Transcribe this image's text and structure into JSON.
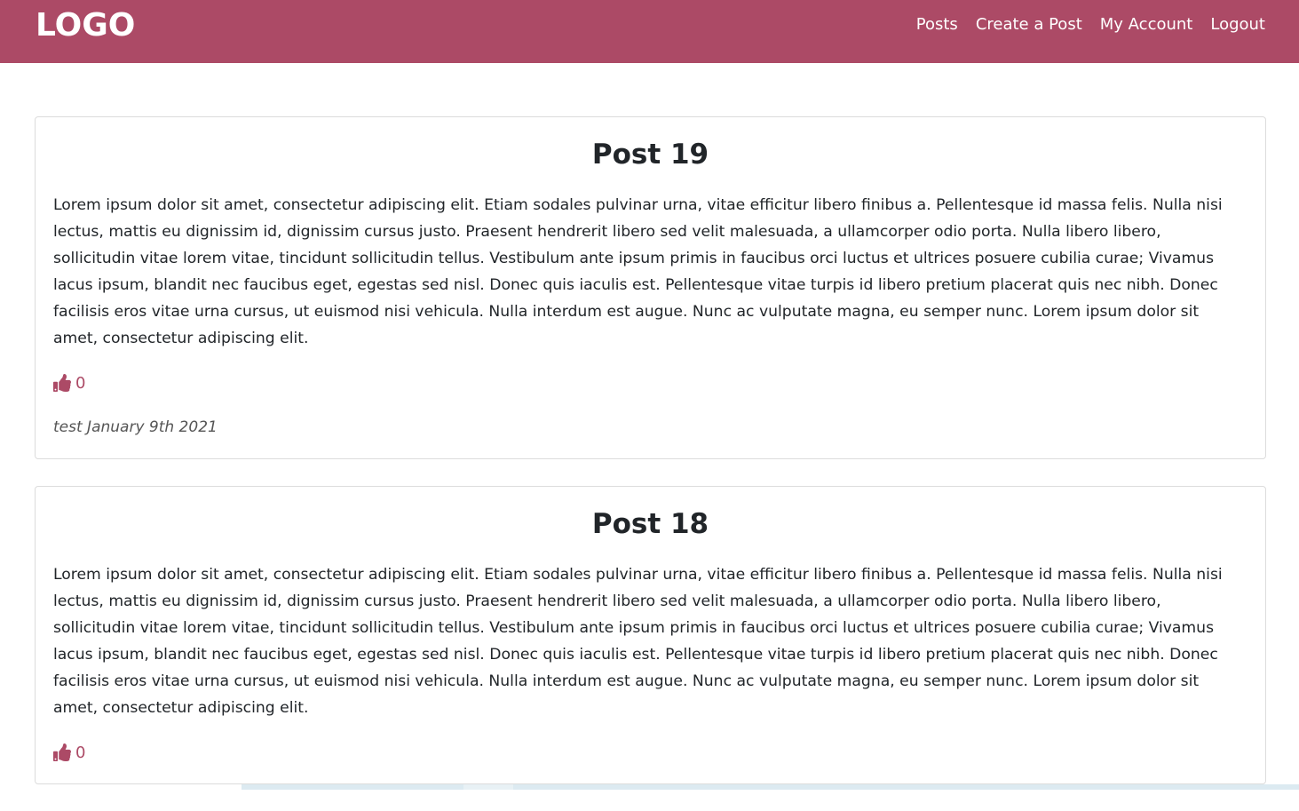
{
  "navbar": {
    "logo": "LOGO",
    "links": [
      "Posts",
      "Create a Post",
      "My Account",
      "Logout"
    ],
    "background_color": "#ac4a66"
  },
  "posts": [
    {
      "title": "Post 19",
      "body": "Lorem ipsum dolor sit amet, consectetur adipiscing elit. Etiam sodales pulvinar urna, vitae efficitur libero finibus a. Pellentesque id massa felis. Nulla nisi lectus, mattis eu dignissim id, dignissim cursus justo. Praesent hendrerit libero sed velit malesuada, a ullamcorper odio porta. Nulla libero libero, sollicitudin vitae lorem vitae, tincidunt sollicitudin tellus. Vestibulum ante ipsum primis in faucibus orci luctus et ultrices posuere cubilia curae; Vivamus lacus ipsum, blandit nec faucibus eget, egestas sed nisl. Donec quis iaculis est. Pellentesque vitae turpis id libero pretium placerat quis nec nibh. Donec facilisis eros vitae urna cursus, ut euismod nisi vehicula. Nulla interdum est augue. Nunc ac vulputate magna, eu semper nunc. Lorem ipsum dolor sit amet, consectetur adipiscing elit.",
      "likes": "0",
      "like_icon": "thumbs-up-icon",
      "meta": "test January 9th 2021"
    },
    {
      "title": "Post 18",
      "body": "Lorem ipsum dolor sit amet, consectetur adipiscing elit. Etiam sodales pulvinar urna, vitae efficitur libero finibus a. Pellentesque id massa felis. Nulla nisi lectus, mattis eu dignissim id, dignissim cursus justo. Praesent hendrerit libero sed velit malesuada, a ullamcorper odio porta. Nulla libero libero, sollicitudin vitae lorem vitae, tincidunt sollicitudin tellus. Vestibulum ante ipsum primis in faucibus orci luctus et ultrices posuere cubilia curae; Vivamus lacus ipsum, blandit nec faucibus eget, egestas sed nisl. Donec quis iaculis est. Pellentesque vitae turpis id libero pretium placerat quis nec nibh. Donec facilisis eros vitae urna cursus, ut euismod nisi vehicula. Nulla interdum est augue. Nunc ac vulputate magna, eu semper nunc. Lorem ipsum dolor sit amet, consectetur adipiscing elit.",
      "likes": "0",
      "like_icon": "thumbs-up-icon"
    }
  ],
  "accent_color": "#ac4a66"
}
